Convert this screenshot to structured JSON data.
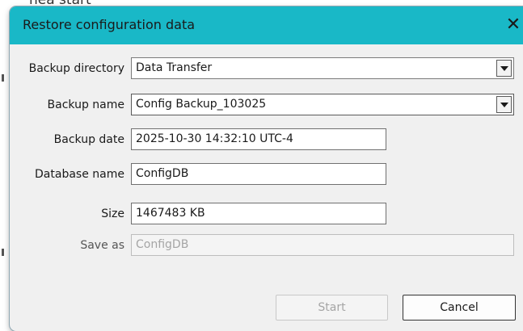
{
  "background": {
    "partial_text": "nea start"
  },
  "dialog": {
    "title": "Restore configuration data",
    "close_icon": "close-icon",
    "title_color": "#19b8c7"
  },
  "form": {
    "backup_directory": {
      "label": "Backup directory",
      "value": "Data Transfer"
    },
    "backup_name": {
      "label": "Backup name",
      "value": "Config Backup_103025"
    },
    "backup_date": {
      "label": "Backup date",
      "value": "2025-10-30 14:32:10 UTC-4"
    },
    "database_name": {
      "label": "Database name",
      "value": "ConfigDB"
    },
    "size": {
      "label": "Size",
      "value": "1467483 KB"
    },
    "save_as": {
      "label": "Save as",
      "value": "ConfigDB"
    }
  },
  "buttons": {
    "start": "Start",
    "cancel": "Cancel"
  }
}
